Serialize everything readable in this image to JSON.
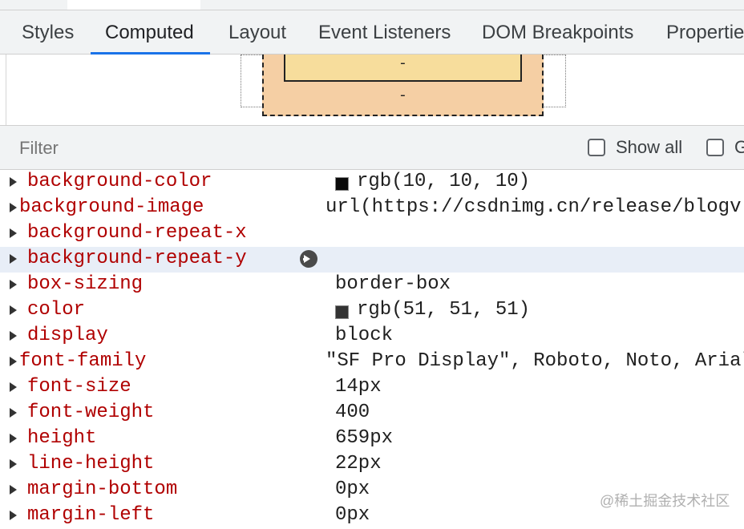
{
  "tabs": [
    {
      "label": "Styles",
      "active": false
    },
    {
      "label": "Computed",
      "active": true
    },
    {
      "label": "Layout",
      "active": false
    },
    {
      "label": "Event Listeners",
      "active": false
    },
    {
      "label": "DOM Breakpoints",
      "active": false
    },
    {
      "label": "Propertie",
      "active": false
    }
  ],
  "box_model": {
    "padding_value": "-",
    "border_value": "-"
  },
  "filter": {
    "placeholder": "Filter",
    "show_all_label": "Show all",
    "group_label": "G"
  },
  "properties": [
    {
      "name": "background-color",
      "value": "rgb(10, 10, 10)",
      "swatch": "#0a0a0a"
    },
    {
      "name": "background-image",
      "value": "url(https://csdnimg.cn/release/blogv"
    },
    {
      "name": "background-repeat-x",
      "value": ""
    },
    {
      "name": "background-repeat-y",
      "value": "",
      "hovered": true,
      "icon": "goto-arrow-icon"
    },
    {
      "name": "box-sizing",
      "value": "border-box"
    },
    {
      "name": "color",
      "value": "rgb(51, 51, 51)",
      "swatch": "#333333"
    },
    {
      "name": "display",
      "value": "block"
    },
    {
      "name": "font-family",
      "value": "\"SF Pro Display\", Roboto, Noto, Arial"
    },
    {
      "name": "font-size",
      "value": "14px"
    },
    {
      "name": "font-weight",
      "value": "400"
    },
    {
      "name": "height",
      "value": "659px"
    },
    {
      "name": "line-height",
      "value": "22px"
    },
    {
      "name": "margin-bottom",
      "value": "0px"
    },
    {
      "name": "margin-left",
      "value": "0px"
    }
  ],
  "watermark": "@稀土掘金技术社区"
}
